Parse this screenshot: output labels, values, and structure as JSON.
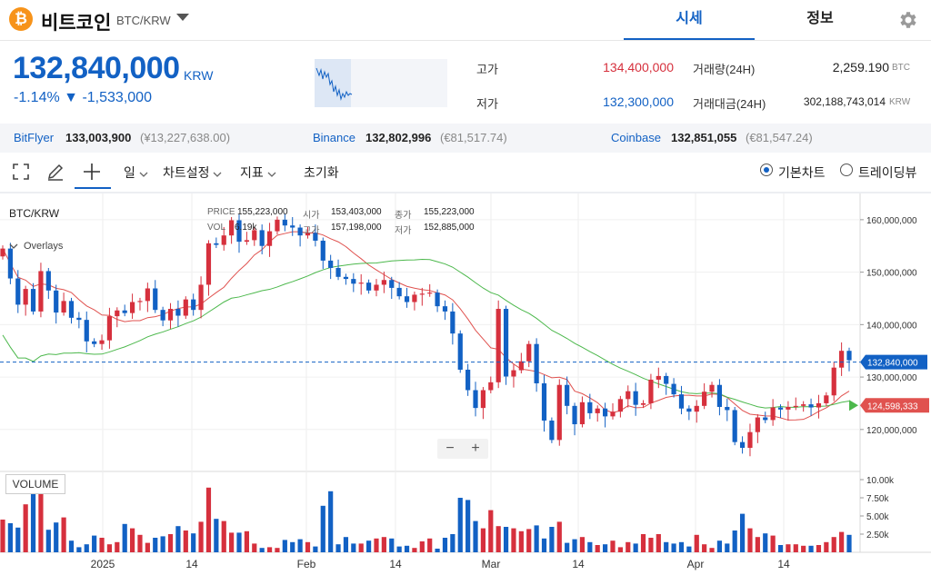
{
  "header": {
    "coin_logo": "₿",
    "coin_name": "비트코인",
    "coin_pair": "BTC/KRW",
    "tabs": [
      {
        "label": "시세"
      },
      {
        "label": "정보"
      }
    ],
    "icons": {
      "dropdown": "chevron-down-icon",
      "settings": "gear-icon"
    }
  },
  "price": {
    "current": "132,840,000",
    "unit": "KRW",
    "change_pct": "-1.14%",
    "change_arrow": "▼",
    "change_abs": "-1,533,000"
  },
  "stats": {
    "high_label": "고가",
    "high_value": "134,400,000",
    "low_label": "저가",
    "low_value": "132,300,000",
    "vol_label": "거래량(24H)",
    "vol_value": "2,259.190",
    "vol_unit": "BTC",
    "amt_label": "거래대금(24H)",
    "amt_value": "302,188,743,014",
    "amt_unit": "KRW"
  },
  "exchanges": [
    {
      "name": "BitFlyer",
      "price": "133,003,900",
      "sub": "(¥13,227,638.00)"
    },
    {
      "name": "Binance",
      "price": "132,802,996",
      "sub": "(€81,517.74)"
    },
    {
      "name": "Coinbase",
      "price": "132,851,055",
      "sub": "(€81,547.24)"
    }
  ],
  "toolbar": {
    "interval": "일",
    "chart_settings": "차트설정",
    "indicators": "지표",
    "reset": "초기화",
    "basic_chart": "기본차트",
    "tradingview": "트레이딩뷰"
  },
  "chart_info": {
    "symbol": "BTC/KRW",
    "overlays": "Overlays",
    "price_label": "PRICE",
    "price_value": "155,223,000",
    "vol_label": "VOL",
    "vol_value": "6.19k",
    "open_label": "시가",
    "open_value": "153,403,000",
    "high_label": "고가",
    "high_value": "157,198,000",
    "close_label": "종가",
    "close_value": "155,223,000",
    "low_label": "저가",
    "low_value": "152,885,000",
    "volume_badge": "VOLUME",
    "zoom_out": "−",
    "zoom_in": "+"
  },
  "colors": {
    "up": "#d6303d",
    "down": "#1261c4",
    "ma_short": "#e0524f",
    "ma_long": "#4cb84c",
    "accent": "#1261c4"
  },
  "chart_data": {
    "type": "candlestick",
    "x_ticks": [
      "2025",
      "14",
      "Feb",
      "14",
      "Mar",
      "14",
      "Apr",
      "14"
    ],
    "price_ticks": [
      "160,000,000",
      "150,000,000",
      "140,000,000",
      "130,000,000",
      "120,000,000"
    ],
    "price_range": [
      112000000,
      165000000
    ],
    "volume_ticks": [
      "10.00k",
      "7.50k",
      "5.00k",
      "2.50k"
    ],
    "volume_range": [
      0,
      11000
    ],
    "current_price_label": "132,840,000",
    "ma_label": "124,598,333",
    "candles_close": [
      154.5,
      148.8,
      143.8,
      146.8,
      142.5,
      150.2,
      146.5,
      142.3,
      144.5,
      141.3,
      140.9,
      136.8,
      136.3,
      137.0,
      141.6,
      142.7,
      142.2,
      144.3,
      144.5,
      146.9,
      142.8,
      140.8,
      143.0,
      141.7,
      144.8,
      142.8,
      147.6,
      155.5,
      155.2,
      157.0,
      159.9,
      155.8,
      156.1,
      158.0,
      155.0,
      157.8,
      160.0,
      158.9,
      158.5,
      157.0,
      157.5,
      156.0,
      152.2,
      150.8,
      149.1,
      148.7,
      147.8,
      148.0,
      146.5,
      147.6,
      148.5,
      147.0,
      145.4,
      144.3,
      145.7,
      145.9,
      146.1,
      143.5,
      142.5,
      138.3,
      131.4,
      127.5,
      124.1,
      127.5,
      129.0,
      143.0,
      130.1,
      131.3,
      133.0,
      136.3,
      128.8,
      121.7,
      118.0,
      128.5,
      124.5,
      121.0,
      125.2,
      123.1,
      124.0,
      122.5,
      123.4,
      125.8,
      127.3,
      124.7,
      125.0,
      129.5,
      130.2,
      128.7,
      126.7,
      124.0,
      123.4,
      124.5,
      127.2,
      128.5,
      124.3,
      123.7,
      117.6,
      116.5,
      119.5,
      122.3,
      121.8,
      124.2,
      123.8,
      124.3,
      124.5,
      124.8,
      124.2,
      125.0,
      126.5,
      131.8,
      135.0,
      133.2
    ],
    "volume": [
      4.5,
      4.0,
      3.4,
      6.6,
      10.0,
      8.8,
      3.1,
      4.1,
      4.8,
      1.6,
      0.7,
      1.1,
      2.3,
      2.0,
      1.1,
      1.4,
      3.9,
      3.3,
      2.4,
      1.3,
      2.0,
      2.2,
      2.5,
      3.6,
      3.0,
      2.6,
      4.2,
      8.9,
      4.6,
      4.3,
      2.7,
      2.7,
      2.9,
      1.2,
      0.6,
      0.7,
      0.6,
      1.7,
      1.4,
      1.8,
      1.4,
      0.8,
      6.4,
      8.4,
      1.1,
      2.1,
      1.2,
      1.2,
      1.6,
      1.9,
      2.1,
      1.9,
      0.8,
      0.9,
      0.6,
      1.5,
      1.9,
      0.5,
      2.0,
      2.5,
      7.5,
      7.2,
      4.3,
      3.3,
      5.8,
      3.6,
      3.5,
      3.3,
      2.9,
      3.2,
      3.7,
      1.9,
      3.5,
      4.2,
      1.3,
      1.8,
      2.1,
      1.4,
      1.0,
      1.1,
      1.6,
      0.7,
      1.4,
      1.2,
      2.5,
      2.0,
      2.5,
      1.4,
      1.2,
      1.4,
      0.8,
      2.4,
      1.1,
      0.6,
      1.6,
      1.2,
      3.0,
      5.3,
      3.3,
      2.1,
      2.6,
      2.3,
      1.0,
      1.1,
      1.1,
      0.9,
      0.9,
      1.0,
      1.4,
      2.1,
      2.8,
      2.4,
      0.6
    ]
  }
}
